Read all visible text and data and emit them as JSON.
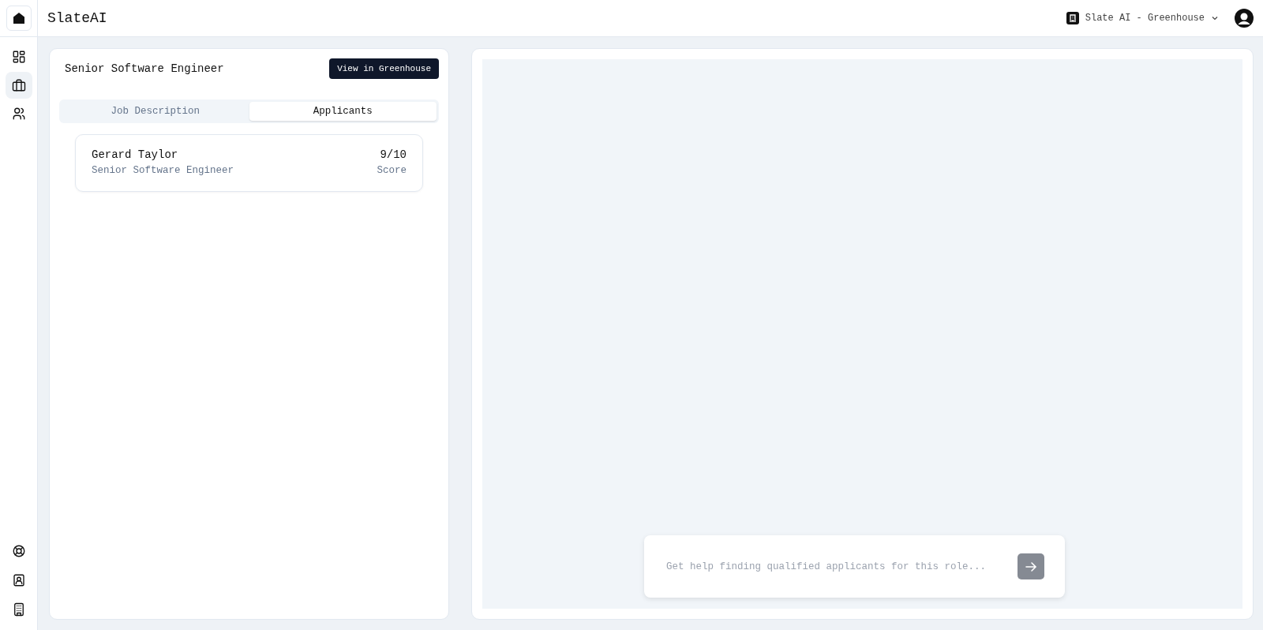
{
  "app": {
    "title": "SlateAI"
  },
  "workspace": {
    "label": "Slate AI - Greenhouse"
  },
  "sidebar": {
    "items": [
      {
        "selected": false
      },
      {
        "selected": true
      },
      {
        "selected": false
      }
    ]
  },
  "job": {
    "title": "Senior Software Engineer",
    "button": "View in Greenhouse"
  },
  "tabs": [
    {
      "label": "Job Description",
      "selected": false
    },
    {
      "label": "Applicants",
      "selected": true
    }
  ],
  "applicants": [
    {
      "name": "Gerard Taylor",
      "role": "Senior Software Engineer",
      "score": "9/10",
      "score_label": "Score"
    }
  ],
  "chat": {
    "placeholder": "Get help finding qualified applicants for this role..."
  }
}
